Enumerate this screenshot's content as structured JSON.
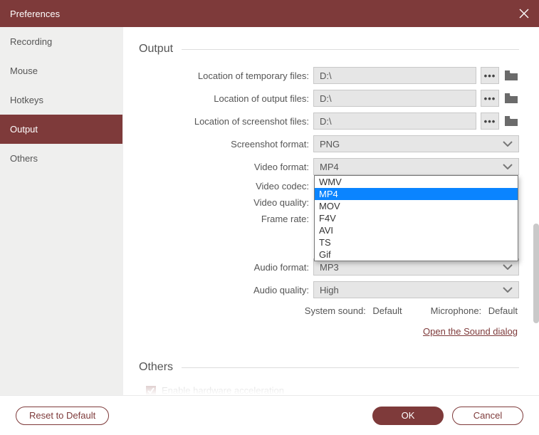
{
  "window": {
    "title": "Preferences"
  },
  "sidebar": {
    "items": [
      {
        "label": "Recording",
        "active": false
      },
      {
        "label": "Mouse",
        "active": false
      },
      {
        "label": "Hotkeys",
        "active": false
      },
      {
        "label": "Output",
        "active": true
      },
      {
        "label": "Others",
        "active": false
      }
    ]
  },
  "output": {
    "title": "Output",
    "temp_label": "Location of temporary files:",
    "temp_value": "D:\\",
    "out_label": "Location of output files:",
    "out_value": "D:\\",
    "shot_label": "Location of screenshot files:",
    "shot_value": "D:\\",
    "shotfmt_label": "Screenshot format:",
    "shotfmt_value": "PNG",
    "videofmt_label": "Video format:",
    "videofmt_value": "MP4",
    "videofmt_options": [
      "WMV",
      "MP4",
      "MOV",
      "F4V",
      "AVI",
      "TS",
      "Gif"
    ],
    "videofmt_selected": "MP4",
    "codec_label": "Video codec:",
    "quality_label": "Video quality:",
    "framerate_label": "Frame rate:",
    "audiofmt_label": "Audio format:",
    "audiofmt_value": "MP3",
    "audioq_label": "Audio quality:",
    "audioq_value": "High",
    "system_sound_label": "System sound:",
    "system_sound_value": "Default",
    "mic_label": "Microphone:",
    "mic_value": "Default",
    "sound_link": "Open the Sound dialog"
  },
  "others": {
    "title": "Others",
    "hwaccel_label": "Enable hardware acceleration"
  },
  "footer": {
    "reset": "Reset to Default",
    "ok": "OK",
    "cancel": "Cancel"
  },
  "icons": {
    "dots": "•••"
  }
}
